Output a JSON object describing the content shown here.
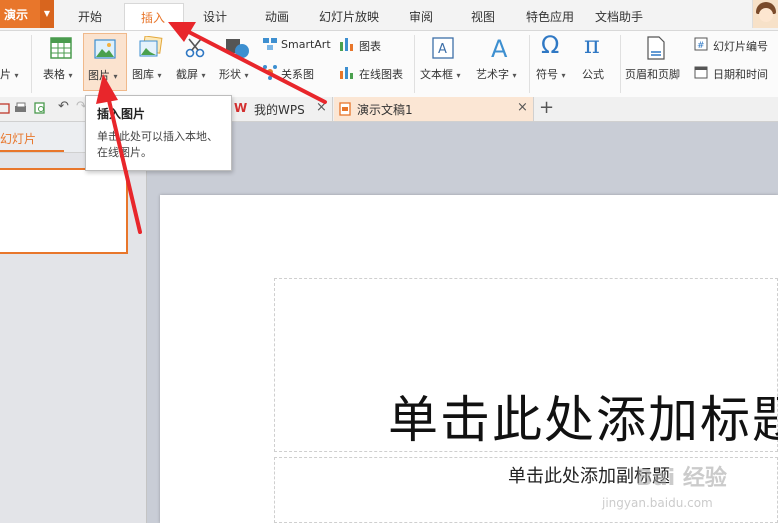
{
  "app": {
    "name": "演示"
  },
  "menu": {
    "items": [
      "开始",
      "插入",
      "设计",
      "动画",
      "幻灯片放映",
      "审阅",
      "视图",
      "特色应用",
      "文档助手"
    ],
    "active": "插入"
  },
  "ribbon": {
    "partial_left": "片",
    "table": "表格",
    "picture": "图片",
    "gallery": "图库",
    "screenshot": "截屏",
    "shape": "形状",
    "smartart": "SmartArt",
    "chart": "图表",
    "relation": "关系图",
    "online_chart": "在线图表",
    "textbox": "文本框",
    "wordart": "艺术字",
    "symbol": "符号",
    "formula": "公式",
    "header_footer": "页眉和页脚",
    "slide_number": "幻灯片编号",
    "datetime": "日期和时间"
  },
  "tabs": {
    "mywps": "我的WPS",
    "doc": "演示文稿1",
    "close": "×",
    "add": "+"
  },
  "panel": {
    "tab": "幻灯片"
  },
  "tooltip": {
    "title": "插入图片",
    "body": "单击此处可以插入本地、在线图片。"
  },
  "slide": {
    "title": "单击此处添加标题",
    "subtitle": "单击此处添加副标题"
  },
  "watermark": {
    "line1": "Bai 经验",
    "line2": "jingyan.baidu.com"
  },
  "colors": {
    "accent": "#e8762b",
    "arrow": "#e8262b"
  }
}
